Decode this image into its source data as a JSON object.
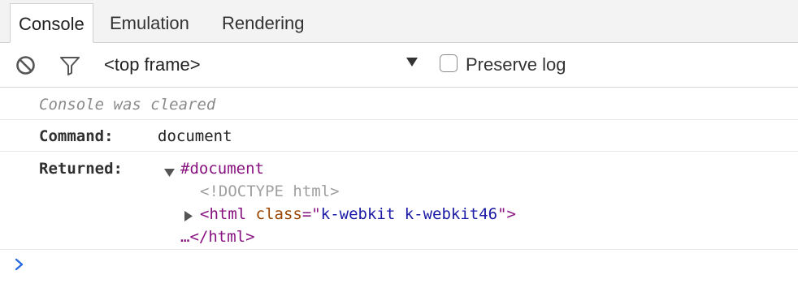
{
  "tabs": [
    {
      "label": "Console",
      "active": true
    },
    {
      "label": "Emulation",
      "active": false
    },
    {
      "label": "Rendering",
      "active": false
    }
  ],
  "toolbar": {
    "clear_icon": "clear-circle-icon",
    "filter_icon": "funnel-icon",
    "frame_select": "<top frame>",
    "preserve_log_label": "Preserve log",
    "preserve_log_checked": false
  },
  "console": {
    "cleared_message": "Console was cleared",
    "command_key": "Command:",
    "command_value": "document",
    "returned_key": "Returned:",
    "document_node": "#document",
    "doctype": "<!DOCTYPE html>",
    "html_tag_open": "<html",
    "html_attr_name": "class",
    "html_attr_eq": "=\"",
    "html_attr_value": "k-webkit k-webkit46",
    "html_attr_close": "\">",
    "html_close": "…</html>"
  },
  "colors": {
    "tag": "#881280",
    "attribute_name": "#994500",
    "attribute_value": "#1a1aa6",
    "muted": "#a0a0a0",
    "prompt": "#2a6ae0"
  }
}
